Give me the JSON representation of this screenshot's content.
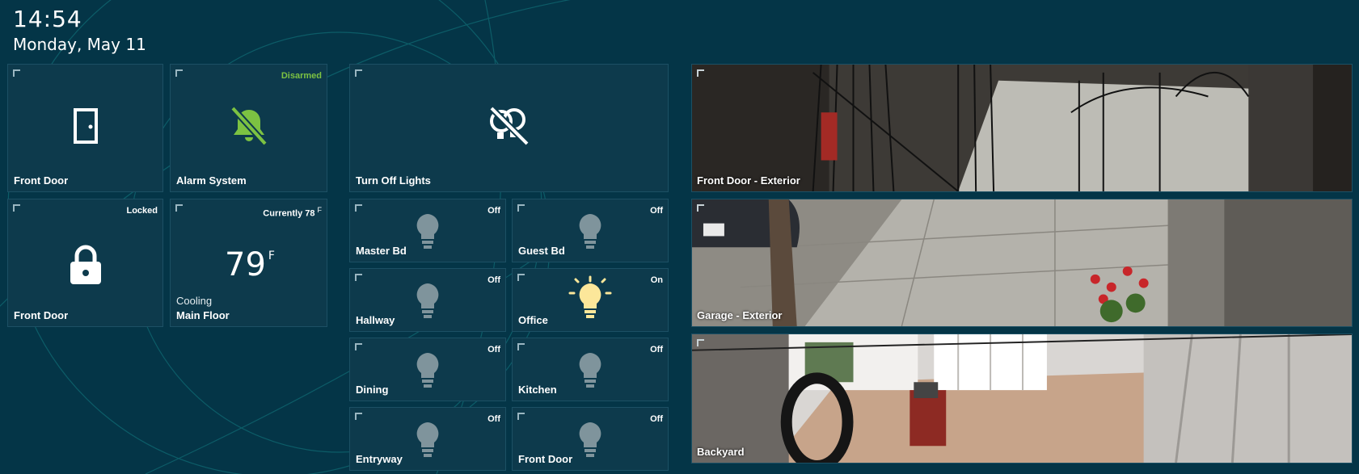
{
  "clock": {
    "time": "14:54",
    "date": "Monday, May 11"
  },
  "colors": {
    "background": "#043547",
    "tile": "#0d3a4c",
    "accent_green": "#7cc242",
    "light_on": "#fce79a",
    "light_off": "#7f949c"
  },
  "tiles": {
    "front_door_sensor": {
      "label": "Front Door",
      "icon": "door-icon"
    },
    "alarm": {
      "label": "Alarm System",
      "status": "Disarmed",
      "icon": "bell-off-icon"
    },
    "turn_off_lights": {
      "label": "Turn Off Lights",
      "icon": "lights-off-icon"
    },
    "front_door_lock": {
      "label": "Front Door",
      "status": "Locked",
      "icon": "lock-icon"
    },
    "thermostat": {
      "label": "Main Floor",
      "status": "Currently 78",
      "status_unit": "F",
      "setpoint": "79",
      "unit": "F",
      "mode": "Cooling"
    }
  },
  "lights": [
    {
      "label": "Master Bd",
      "state": "Off"
    },
    {
      "label": "Guest Bd",
      "state": "Off"
    },
    {
      "label": "Hallway",
      "state": "Off"
    },
    {
      "label": "Office",
      "state": "On"
    },
    {
      "label": "Dining",
      "state": "Off"
    },
    {
      "label": "Kitchen",
      "state": "Off"
    },
    {
      "label": "Entryway",
      "state": "Off"
    },
    {
      "label": "Front Door",
      "state": "Off"
    }
  ],
  "cameras": [
    {
      "label": "Front Door - Exterior"
    },
    {
      "label": "Garage - Exterior"
    },
    {
      "label": "Backyard"
    }
  ]
}
